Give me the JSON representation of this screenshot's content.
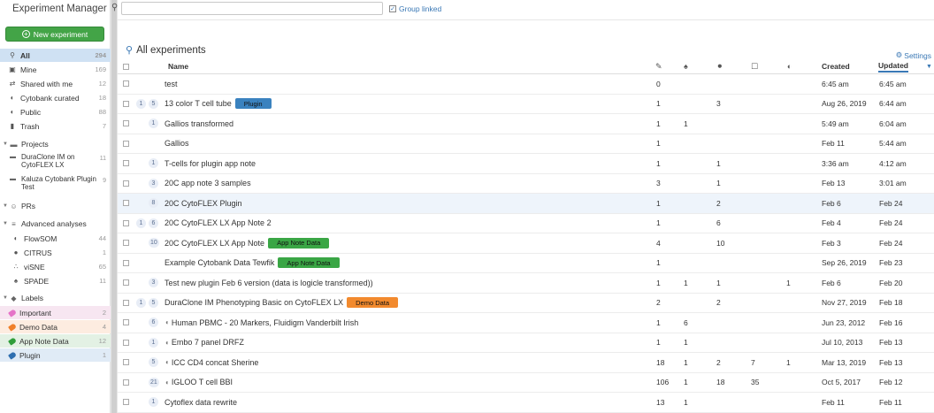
{
  "app": {
    "title": "Experiment Manager"
  },
  "sidebar": {
    "new_button": "New experiment",
    "nav": [
      {
        "label": "All",
        "count": "294",
        "icon": "search-icon"
      },
      {
        "label": "Mine",
        "count": "169",
        "icon": "lock-icon"
      },
      {
        "label": "Shared with me",
        "count": "12",
        "icon": "share-icon"
      },
      {
        "label": "Cytobank curated",
        "count": "18",
        "icon": "globe-icon"
      },
      {
        "label": "Public",
        "count": "88",
        "icon": "globe-icon"
      },
      {
        "label": "Trash",
        "count": "7",
        "icon": "trash-icon"
      }
    ],
    "projects_label": "Projects",
    "projects": [
      {
        "label": "DuraClone IM on CytoFLEX LX",
        "count": "11"
      },
      {
        "label": "Kaluza Cytobank Plugin Test",
        "count": "9"
      }
    ],
    "prs_label": "PRs",
    "advanced_label": "Advanced analyses",
    "advanced": [
      {
        "label": "FlowSOM",
        "count": "44"
      },
      {
        "label": "CITRUS",
        "count": "1"
      },
      {
        "label": "viSNE",
        "count": "65"
      },
      {
        "label": "SPADE",
        "count": "11"
      }
    ],
    "labels_label": "Labels",
    "labels": [
      {
        "label": "Important",
        "count": "2",
        "color": "#e573c8",
        "bg": "#f7e6f1"
      },
      {
        "label": "Demo Data",
        "count": "4",
        "color": "#f07f28",
        "bg": "#fdece0"
      },
      {
        "label": "App Note Data",
        "count": "12",
        "color": "#2f9e3b",
        "bg": "#e3f1e4"
      },
      {
        "label": "Plugin",
        "count": "1",
        "color": "#2f6fb0",
        "bg": "#e0ebf6"
      }
    ]
  },
  "search": {
    "value": "",
    "placeholder": ""
  },
  "group_linked": {
    "label": "Group linked",
    "checked": true
  },
  "main": {
    "title": "All experiments",
    "settings_label": "Settings",
    "columns": {
      "name": "Name",
      "created": "Created",
      "updated": "Updated"
    },
    "rows": [
      {
        "b1": "",
        "b2": "",
        "name": "test",
        "public": false,
        "tag": "",
        "c1": "0",
        "c2": "",
        "c3": "",
        "c4": "",
        "c5": "",
        "created": "6:45 am",
        "updated": "6:45 am"
      },
      {
        "b1": "1",
        "b2": "5",
        "name": "13 color T cell tube",
        "public": false,
        "tag": "Plugin",
        "c1": "1",
        "c2": "",
        "c3": "3",
        "c4": "",
        "c5": "",
        "created": "Aug 26, 2019",
        "updated": "6:44 am"
      },
      {
        "b1": "",
        "b2": "1",
        "name": "Gallios transformed",
        "public": false,
        "tag": "",
        "c1": "1",
        "c2": "1",
        "c3": "",
        "c4": "",
        "c5": "",
        "created": "5:49 am",
        "updated": "6:04 am"
      },
      {
        "b1": "",
        "b2": "",
        "name": "Gallios",
        "public": false,
        "tag": "",
        "c1": "1",
        "c2": "",
        "c3": "",
        "c4": "",
        "c5": "",
        "created": "Feb 11",
        "updated": "5:44 am"
      },
      {
        "b1": "",
        "b2": "1",
        "name": "T-cells for plugin app note",
        "public": false,
        "tag": "",
        "c1": "1",
        "c2": "",
        "c3": "1",
        "c4": "",
        "c5": "",
        "created": "3:36 am",
        "updated": "4:12 am"
      },
      {
        "b1": "",
        "b2": "3",
        "name": "20C app note 3 samples",
        "public": false,
        "tag": "",
        "c1": "3",
        "c2": "",
        "c3": "1",
        "c4": "",
        "c5": "",
        "created": "Feb 13",
        "updated": "3:01 am"
      },
      {
        "b1": "",
        "b2": "8",
        "name": "20C CytoFLEX Plugin",
        "public": false,
        "tag": "",
        "c1": "1",
        "c2": "",
        "c3": "2",
        "c4": "",
        "c5": "",
        "created": "Feb 6",
        "updated": "Feb 24"
      },
      {
        "b1": "1",
        "b2": "6",
        "name": "20C CytoFLEX LX App Note 2",
        "public": false,
        "tag": "",
        "c1": "1",
        "c2": "",
        "c3": "6",
        "c4": "",
        "c5": "",
        "created": "Feb 4",
        "updated": "Feb 24"
      },
      {
        "b1": "",
        "b2": "10",
        "name": "20C CytoFLEX LX App Note",
        "public": false,
        "tag": "App Note Data",
        "c1": "4",
        "c2": "",
        "c3": "10",
        "c4": "",
        "c5": "",
        "created": "Feb 3",
        "updated": "Feb 24"
      },
      {
        "b1": "",
        "b2": "",
        "name": "Example Cytobank Data Tewfik",
        "public": false,
        "tag": "App Note Data",
        "c1": "1",
        "c2": "",
        "c3": "",
        "c4": "",
        "c5": "",
        "created": "Sep 26, 2019",
        "updated": "Feb 23"
      },
      {
        "b1": "",
        "b2": "3",
        "name": "Test new plugin Feb 6 version (data is logicle transformed))",
        "public": false,
        "tag": "",
        "c1": "1",
        "c2": "1",
        "c3": "1",
        "c4": "",
        "c5": "1",
        "created": "Feb 6",
        "updated": "Feb 20"
      },
      {
        "b1": "1",
        "b2": "5",
        "name": "DuraClone IM Phenotyping Basic on CytoFLEX LX",
        "public": false,
        "tag": "Demo Data",
        "c1": "2",
        "c2": "",
        "c3": "2",
        "c4": "",
        "c5": "",
        "created": "Nov 27, 2019",
        "updated": "Feb 18"
      },
      {
        "b1": "",
        "b2": "6",
        "name": "Human PBMC - 20 Markers, Fluidigm Vanderbilt Irish",
        "public": true,
        "tag": "",
        "c1": "1",
        "c2": "6",
        "c3": "",
        "c4": "",
        "c5": "",
        "created": "Jun 23, 2012",
        "updated": "Feb 16"
      },
      {
        "b1": "",
        "b2": "1",
        "name": "Embo 7 panel DRFZ",
        "public": true,
        "tag": "",
        "c1": "1",
        "c2": "1",
        "c3": "",
        "c4": "",
        "c5": "",
        "created": "Jul 10, 2013",
        "updated": "Feb 13"
      },
      {
        "b1": "",
        "b2": "5",
        "name": "ICC CD4 concat Sherine",
        "public": true,
        "tag": "",
        "c1": "18",
        "c2": "1",
        "c3": "2",
        "c4": "7",
        "c5": "1",
        "created": "Mar 13, 2019",
        "updated": "Feb 13"
      },
      {
        "b1": "",
        "b2": "21",
        "name": "IGLOO T cell BBI",
        "public": true,
        "tag": "",
        "c1": "106",
        "c2": "1",
        "c3": "18",
        "c4": "35",
        "c5": "",
        "created": "Oct 5, 2017",
        "updated": "Feb 12"
      },
      {
        "b1": "",
        "b2": "1",
        "name": "Cytoflex data rewrite",
        "public": false,
        "tag": "",
        "c1": "13",
        "c2": "1",
        "c3": "",
        "c4": "",
        "c5": "",
        "created": "Feb 11",
        "updated": "Feb 11"
      }
    ],
    "tag_colors": {
      "Plugin": "#3a82bf",
      "App Note Data": "#3aa645",
      "Demo Data": "#f28a2e"
    }
  }
}
